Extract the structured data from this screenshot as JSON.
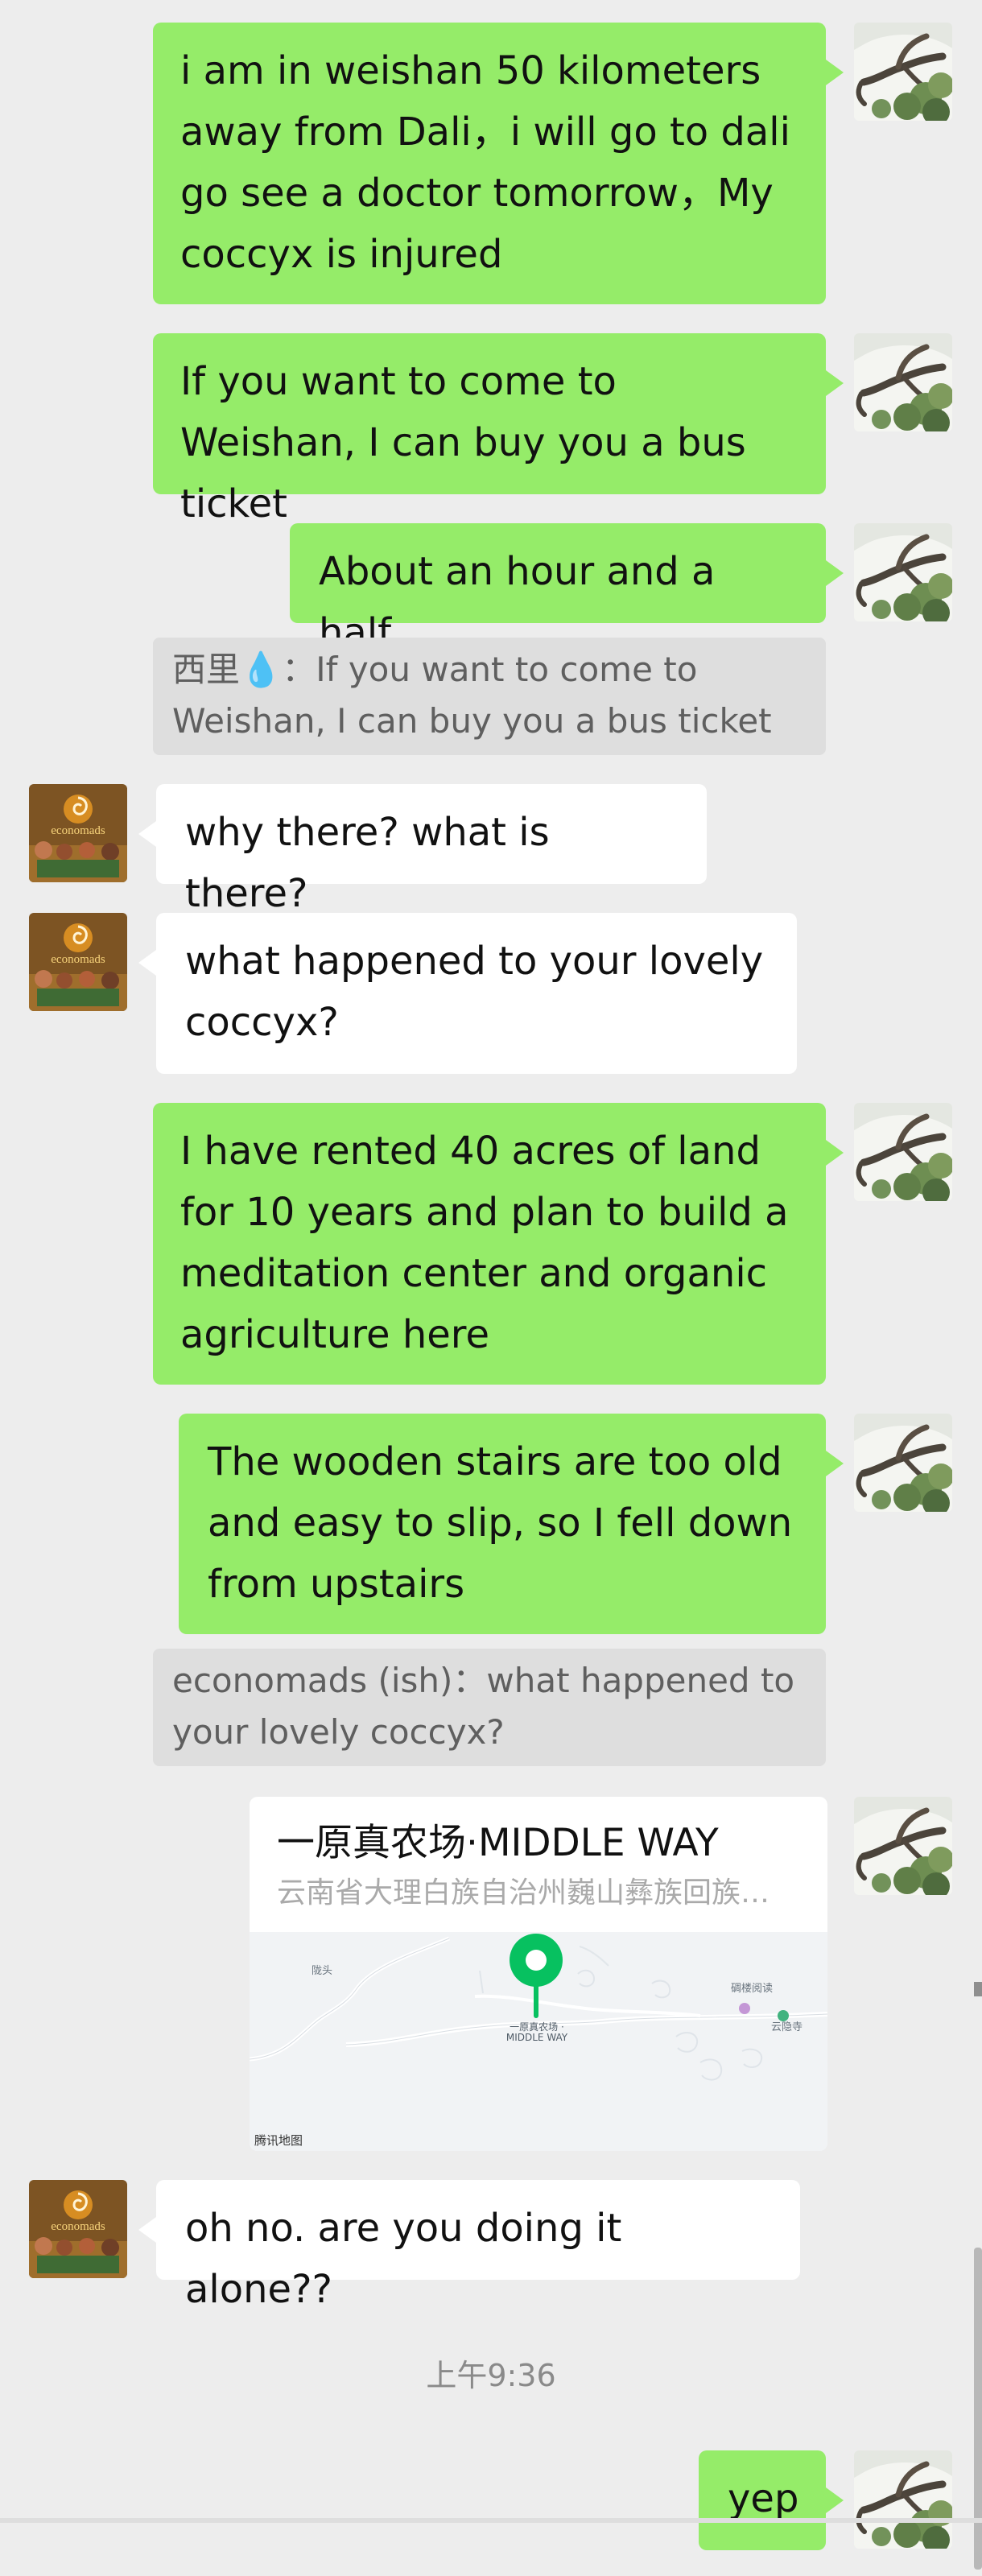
{
  "chat": {
    "messages": [
      {
        "side": "right",
        "type": "text",
        "text": "i am in weishan 50 kilometers away from Dali，i will go to dali go see a doctor tomorrow，My coccyx is injured",
        "avatar_icon": "tree-branch-photo-icon"
      },
      {
        "side": "right",
        "type": "text",
        "text": "If you want to come to Weishan, I can buy you a bus ticket",
        "avatar_icon": "tree-branch-photo-icon"
      },
      {
        "side": "right",
        "type": "text",
        "text": "About an hour and a half",
        "avatar_icon": "tree-branch-photo-icon"
      },
      {
        "side": "right",
        "type": "quote",
        "text": "西里💧：If you want to come to Weishan, I can buy you a bus ticket"
      },
      {
        "side": "left",
        "type": "text",
        "text": "why there? what is there?",
        "avatar_icon": "economads-logo-avatar-icon"
      },
      {
        "side": "left",
        "type": "text",
        "text": "what happened to your lovely coccyx?",
        "avatar_icon": "economads-logo-avatar-icon"
      },
      {
        "side": "right",
        "type": "text",
        "text": "I have rented 40 acres of land for 10 years and plan to build a meditation center and organic agriculture here",
        "avatar_icon": "tree-branch-photo-icon"
      },
      {
        "side": "right",
        "type": "text",
        "text": "The wooden stairs are too old and easy to slip, so I fell down from upstairs",
        "avatar_icon": "tree-branch-photo-icon"
      },
      {
        "side": "right",
        "type": "quote",
        "text": "economads (ish)：what happened to your lovely coccyx?"
      },
      {
        "side": "right",
        "type": "location",
        "title": "一原真农场·MIDDLE WAY",
        "address": "云南省大理白族自治州巍山彝族回族自...",
        "map_labels": {
          "pin": "一原真农场 · MIDDLE WAY",
          "top_left": "陇头",
          "bookshop": "碉楼阅读",
          "temple": "云隐寺",
          "provider": "腾讯地图"
        },
        "avatar_icon": "tree-branch-photo-icon"
      },
      {
        "side": "left",
        "type": "text",
        "text": "oh no. are you doing it alone??",
        "avatar_icon": "economads-logo-avatar-icon"
      },
      {
        "side": "center",
        "type": "timestamp",
        "text": "上午9:36"
      },
      {
        "side": "right",
        "type": "text",
        "text": "yep",
        "avatar_icon": "tree-branch-photo-icon"
      }
    ]
  },
  "avatars": {
    "economads_logo_text": "economads"
  },
  "colors": {
    "background": "#ededed",
    "my_bubble": "#95ec69",
    "their_bubble": "#ffffff",
    "quote_bubble": "#dedede",
    "map_pin": "#07c160"
  }
}
